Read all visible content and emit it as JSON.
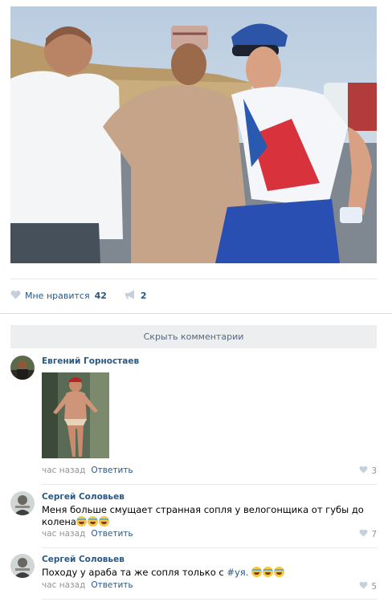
{
  "post": {
    "likes": {
      "label": "Мне нравится",
      "count": "42"
    },
    "reposts": {
      "count": "2"
    }
  },
  "comments_bar": {
    "hide_label": "Скрыть комментарии"
  },
  "comments": [
    {
      "author": "Евгений Горностаев",
      "text": "",
      "time": "час назад",
      "reply": "Ответить",
      "likes": "3"
    },
    {
      "author": "Сергей Соловьев",
      "text": "Меня больше смущает странная сопля у велогонщика от губы до колена",
      "time": "час назад",
      "reply": "Ответить",
      "likes": "7"
    },
    {
      "author": "Сергей Соловьев",
      "text": "Походу у араба та же сопля только с ",
      "hashtag": "#уя.",
      "time": "час назад",
      "reply": "Ответить",
      "likes": "5"
    }
  ],
  "colors": {
    "link": "#2a5885",
    "meta": "#939393",
    "divider": "#e7e8ec",
    "bar": "#edeef0"
  },
  "icons": [
    "heart-icon",
    "megaphone-icon",
    "laughing-emoji-icon"
  ]
}
